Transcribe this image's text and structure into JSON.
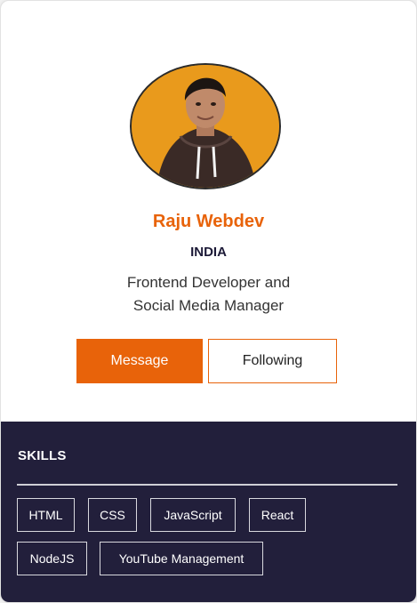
{
  "profile": {
    "name": "Raju Webdev",
    "country": "INDIA",
    "bio_line1": "Frontend Developer and",
    "bio_line2": "Social Media Manager"
  },
  "actions": {
    "message_label": "Message",
    "following_label": "Following"
  },
  "skills": {
    "title": "SKILLS",
    "items": [
      "HTML",
      "CSS",
      "JavaScript",
      "React",
      "NodeJS",
      "YouTube Management"
    ]
  },
  "colors": {
    "accent": "#e8630a",
    "skills_bg": "#221f3b",
    "avatar_bg": "#e99a1c"
  }
}
